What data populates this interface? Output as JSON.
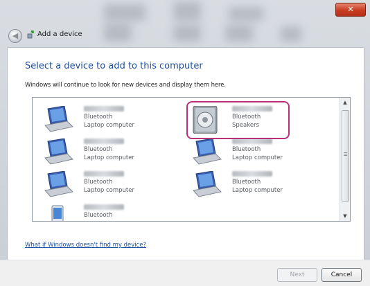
{
  "window": {
    "title": "Add a device",
    "close_glyph": "✕"
  },
  "main": {
    "heading": "Select a device to add to this computer",
    "subtext": "Windows will continue to look for new devices and display them here.",
    "help_link": "What if Windows doesn't find my device?"
  },
  "devices": [
    {
      "name": "",
      "line1": "Bluetooth",
      "line2": "Laptop computer",
      "icon": "laptop-icon"
    },
    {
      "name": "",
      "line1": "Bluetooth",
      "line2": "Speakers",
      "icon": "speaker-icon",
      "highlighted": true
    },
    {
      "name": "",
      "line1": "Bluetooth",
      "line2": "Laptop computer",
      "icon": "laptop-icon"
    },
    {
      "name": "",
      "line1": "Bluetooth",
      "line2": "Laptop computer",
      "icon": "laptop-icon"
    },
    {
      "name": "",
      "line1": "Bluetooth",
      "line2": "Laptop computer",
      "icon": "laptop-icon"
    },
    {
      "name": "",
      "line1": "Bluetooth",
      "line2": "Laptop computer",
      "icon": "laptop-icon"
    },
    {
      "name": "",
      "line1": "Bluetooth",
      "line2": "",
      "icon": "phone-icon"
    }
  ],
  "buttons": {
    "next": "Next",
    "cancel": "Cancel"
  },
  "colors": {
    "highlight": "#b8307a",
    "heading": "#1e4fa0"
  }
}
